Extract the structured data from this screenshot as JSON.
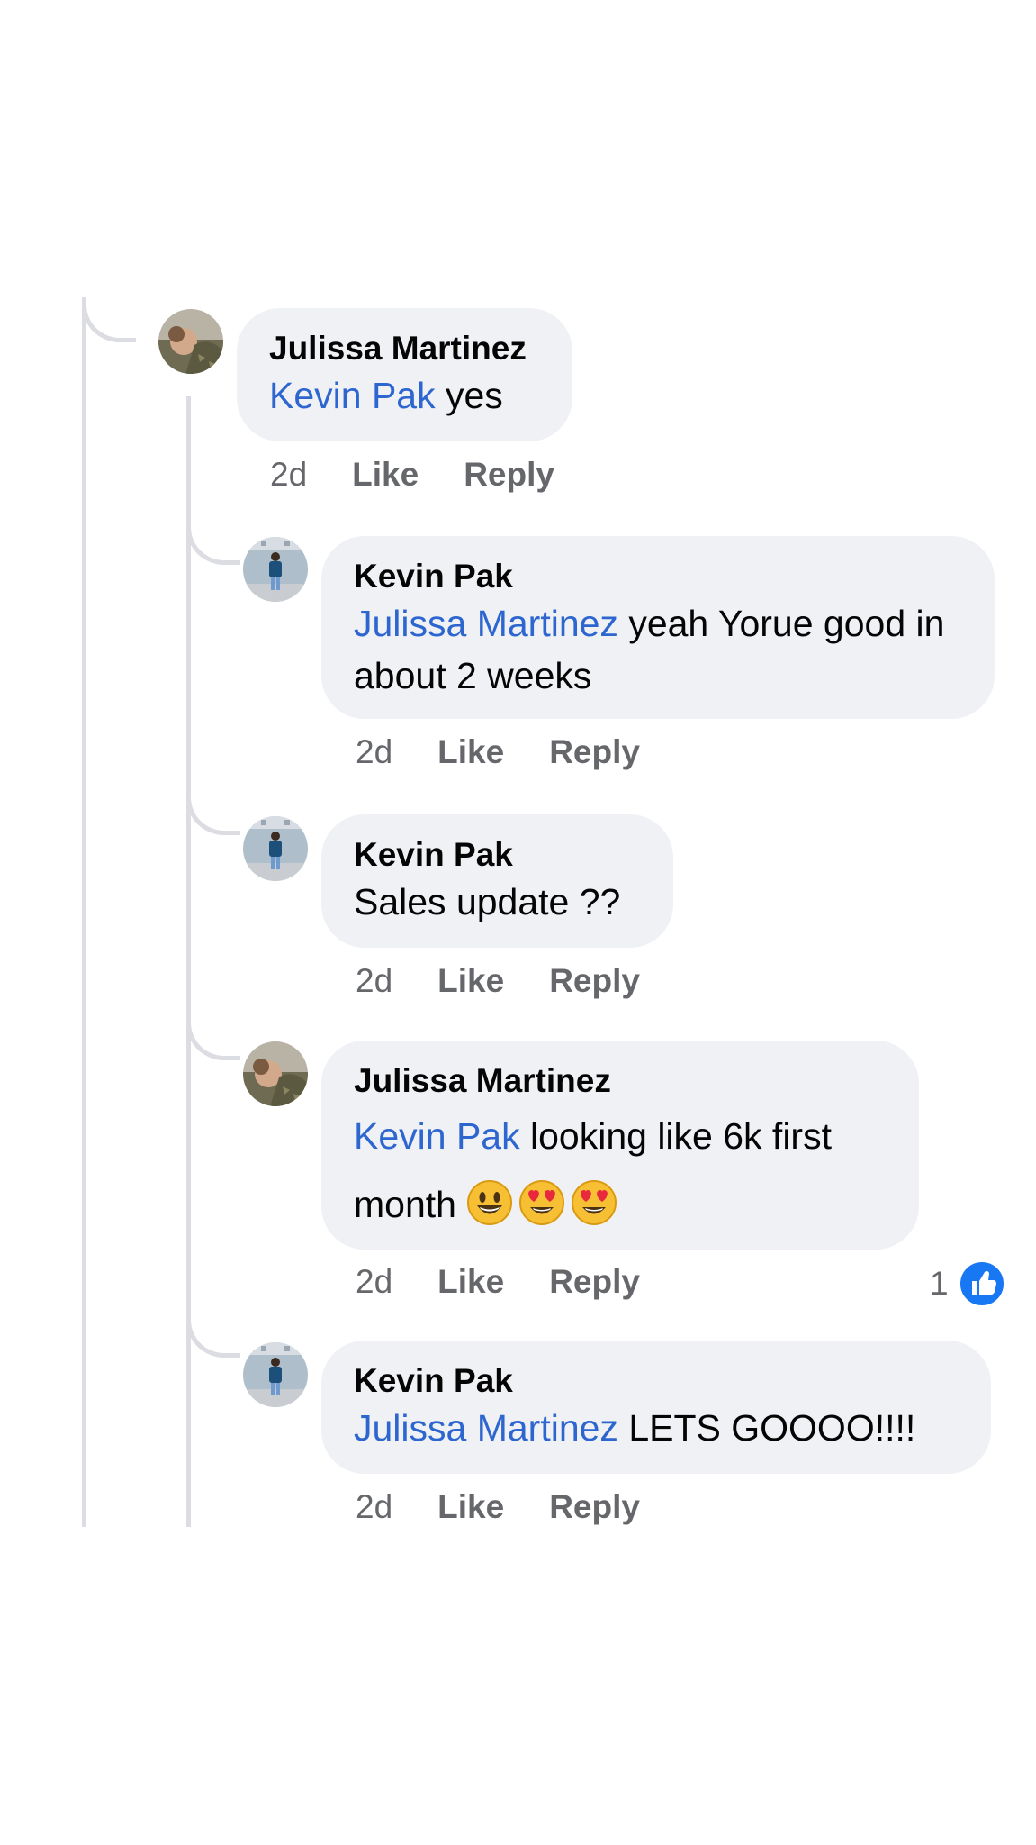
{
  "comments": [
    {
      "author": "Julissa Martinez",
      "mention": "Kevin Pak",
      "text": " yes",
      "time": "2d",
      "like_label": "Like",
      "reply_label": "Reply"
    },
    {
      "author": "Kevin Pak",
      "mention": "Julissa Martinez",
      "text": " yeah Yorue good in about 2 weeks",
      "time": "2d",
      "like_label": "Like",
      "reply_label": "Reply"
    },
    {
      "author": "Kevin Pak",
      "text": "Sales update ??",
      "time": "2d",
      "like_label": "Like",
      "reply_label": "Reply"
    },
    {
      "author": "Julissa Martinez",
      "mention": "Kevin Pak",
      "text": " looking like 6k first month ",
      "emojis": [
        "grinning-face",
        "heart-eyes-face",
        "heart-eyes-face"
      ],
      "time": "2d",
      "like_label": "Like",
      "reply_label": "Reply",
      "reaction_count": "1",
      "reaction_icon": "thumbs-up-icon"
    },
    {
      "author": "Kevin Pak",
      "mention": "Julissa Martinez",
      "text": " LETS GOOOO!!!!",
      "time": "2d",
      "like_label": "Like",
      "reply_label": "Reply"
    }
  ],
  "colors": {
    "mention": "#2e66d0",
    "bubble": "#f0f1f5",
    "meta": "#65676b",
    "thread_line": "#dcdde2",
    "like_badge": "#1877f2"
  }
}
